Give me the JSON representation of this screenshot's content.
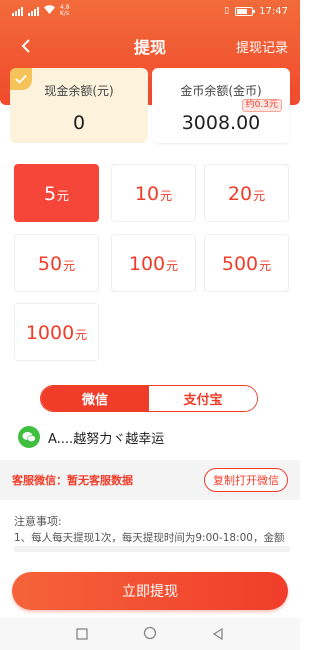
{
  "status_bar": {
    "net_speed_value": "4.8",
    "net_speed_unit": "K/s",
    "time": "17:47"
  },
  "header": {
    "title": "提现",
    "record_link": "提现记录"
  },
  "balance": {
    "cash_label": "现金余额(元)",
    "cash_value": "0",
    "coin_label": "金币余额(金币)",
    "coin_value": "3008.00",
    "coin_approx": "约0.3元"
  },
  "amounts": [
    {
      "num": "5",
      "unit": "元",
      "selected": true
    },
    {
      "num": "10",
      "unit": "元"
    },
    {
      "num": "20",
      "unit": "元"
    },
    {
      "num": "50",
      "unit": "元"
    },
    {
      "num": "100",
      "unit": "元"
    },
    {
      "num": "500",
      "unit": "元"
    },
    {
      "num": "1000",
      "unit": "元"
    }
  ],
  "payment": {
    "tabs": [
      "微信",
      "支付宝"
    ],
    "active_index": 0,
    "account_name": "A....越努力ヾ越幸运"
  },
  "service": {
    "text": "客服微信：暂无客服数据",
    "copy_button": "复制打开微信"
  },
  "notes": {
    "title": "注意事项:",
    "line1": "1、每人每天提现1次，每天提现时间为9:00-18:00，金额"
  },
  "submit_button": "立即提现",
  "colors": {
    "accent": "#f03d2a",
    "header_gradient_top": "#f26b3a",
    "cash_card_bg": "#fdf3dd",
    "check_badge": "#f6c35b",
    "wechat_green": "#3fbf3f"
  }
}
